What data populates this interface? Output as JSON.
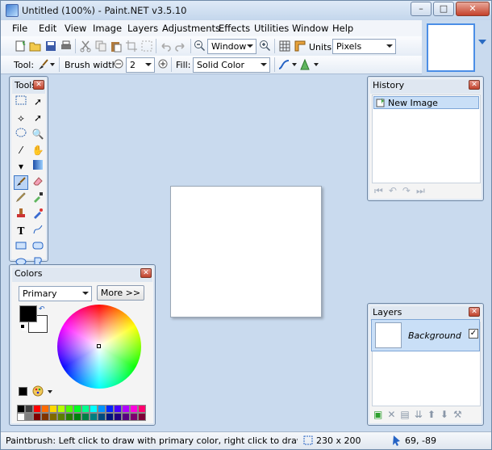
{
  "window": {
    "title": "Untitled (100%) - Paint.NET v3.5.10"
  },
  "menu": [
    {
      "label": "File"
    },
    {
      "label": "Edit"
    },
    {
      "label": "View"
    },
    {
      "label": "Image"
    },
    {
      "label": "Layers"
    },
    {
      "label": "Adjustments"
    },
    {
      "label": "Effects"
    },
    {
      "label": "Utilities"
    },
    {
      "label": "Window"
    },
    {
      "label": "Help"
    }
  ],
  "toolbar": {
    "zoom_value": "Window",
    "units_label": "Units:",
    "units_value": "Pixels",
    "tool_label": "Tool:",
    "brush_width_label": "Brush width:",
    "brush_width_value": "2",
    "fill_label": "Fill:",
    "fill_value": "Solid Color"
  },
  "tools_panel": {
    "title": "Tools",
    "selected_tool": "Paintbrush",
    "tools": [
      "rectangle-select-icon",
      "move-selection-icon",
      "lasso-select-icon",
      "move-selected-icon",
      "ellipse-select-icon",
      "zoom-icon",
      "magic-wand-icon",
      "pan-icon",
      "paint-bucket-icon",
      "gradient-icon",
      "paintbrush-icon",
      "eraser-icon",
      "pencil-icon",
      "color-picker-icon",
      "clone-stamp-icon",
      "recolor-icon",
      "text-icon",
      "line-curve-icon",
      "rectangle-icon",
      "rounded-rectangle-icon",
      "ellipse-icon",
      "freeform-shape-icon"
    ]
  },
  "history_panel": {
    "title": "History",
    "items": [
      {
        "label": "New Image"
      }
    ]
  },
  "layers_panel": {
    "title": "Layers",
    "items": [
      {
        "name": "Background",
        "visible": true
      }
    ]
  },
  "colors_panel": {
    "title": "Colors",
    "mode": "Primary",
    "more_label": "More >>",
    "primary_color": "#000000",
    "secondary_color": "#ffffff",
    "palette": [
      "#000000",
      "#404040",
      "#ff0000",
      "#ff6a00",
      "#ffd800",
      "#b6ff00",
      "#4cff00",
      "#00ff21",
      "#00ff90",
      "#00ffff",
      "#0094ff",
      "#0026ff",
      "#4800ff",
      "#b200ff",
      "#ff00dc",
      "#ff006e",
      "#ffffff",
      "#808080",
      "#7f0000",
      "#7f3300",
      "#7f6a00",
      "#5b7f00",
      "#267f00",
      "#007f0e",
      "#007f46",
      "#007f7f",
      "#004a7f",
      "#00137f",
      "#21007f",
      "#57007f",
      "#7f006e",
      "#7f0037"
    ]
  },
  "status": {
    "message": "Paintbrush: Left click to draw with primary color, right click to draw with secondary c",
    "image_size": "230 x 200",
    "cursor_position": "69, -89"
  },
  "colors": {
    "accent": "#3d78c7",
    "panel_bg": "#f4f4f4",
    "workspace_bg": "#c9daee"
  }
}
